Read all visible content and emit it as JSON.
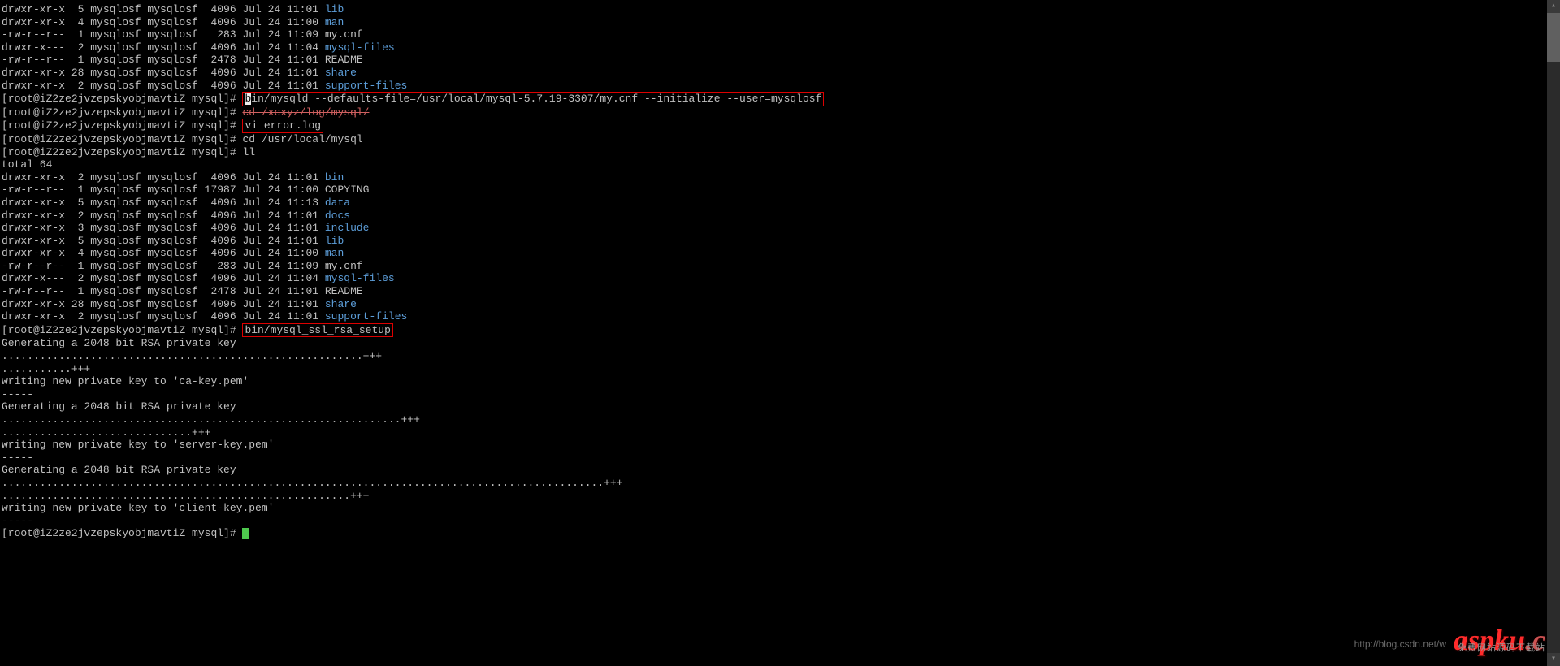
{
  "colors": {
    "dir": "#5c9dd8",
    "text": "#c0c0c0",
    "bg": "#000000",
    "box": "#d00000",
    "cursor": "#4ec94e"
  },
  "prompt": "[root@iZ2ze2jvzepskyobjmavtiZ mysql]# ",
  "listing1": [
    {
      "perm": "drwxr-xr-x",
      "n": "5",
      "u": "mysqlosf",
      "g": "mysqlosf",
      "size": "4096",
      "date": "Jul 24 11:01",
      "name": "lib",
      "dir": true
    },
    {
      "perm": "drwxr-xr-x",
      "n": "4",
      "u": "mysqlosf",
      "g": "mysqlosf",
      "size": "4096",
      "date": "Jul 24 11:00",
      "name": "man",
      "dir": true
    },
    {
      "perm": "-rw-r--r--",
      "n": "1",
      "u": "mysqlosf",
      "g": "mysqlosf",
      "size": "283",
      "date": "Jul 24 11:09",
      "name": "my.cnf",
      "dir": false
    },
    {
      "perm": "drwxr-x---",
      "n": "2",
      "u": "mysqlosf",
      "g": "mysqlosf",
      "size": "4096",
      "date": "Jul 24 11:04",
      "name": "mysql-files",
      "dir": true
    },
    {
      "perm": "-rw-r--r--",
      "n": "1",
      "u": "mysqlosf",
      "g": "mysqlosf",
      "size": "2478",
      "date": "Jul 24 11:01",
      "name": "README",
      "dir": false
    },
    {
      "perm": "drwxr-xr-x",
      "n": "28",
      "u": "mysqlosf",
      "g": "mysqlosf",
      "size": "4096",
      "date": "Jul 24 11:01",
      "name": "share",
      "dir": true
    },
    {
      "perm": "drwxr-xr-x",
      "n": "2",
      "u": "mysqlosf",
      "g": "mysqlosf",
      "size": "4096",
      "date": "Jul 24 11:01",
      "name": "support-files",
      "dir": true
    }
  ],
  "cmd1_firstchar": "b",
  "cmd1_rest": "in/mysqld --defaults-file=/usr/local/mysql-5.7.19-3307/my.cnf --initialize --user=mysqlosf",
  "cmd2": "cd /xcxyz/log/mysql/",
  "cmd3": "vi error.log",
  "cmd4": "cd /usr/local/mysql",
  "cmd5": "ll",
  "total": "total 64",
  "listing2": [
    {
      "perm": "drwxr-xr-x",
      "n": "2",
      "u": "mysqlosf",
      "g": "mysqlosf",
      "size": "4096",
      "date": "Jul 24 11:01",
      "name": "bin",
      "dir": true
    },
    {
      "perm": "-rw-r--r--",
      "n": "1",
      "u": "mysqlosf",
      "g": "mysqlosf",
      "size": "17987",
      "date": "Jul 24 11:00",
      "name": "COPYING",
      "dir": false
    },
    {
      "perm": "drwxr-xr-x",
      "n": "5",
      "u": "mysqlosf",
      "g": "mysqlosf",
      "size": "4096",
      "date": "Jul 24 11:13",
      "name": "data",
      "dir": true
    },
    {
      "perm": "drwxr-xr-x",
      "n": "2",
      "u": "mysqlosf",
      "g": "mysqlosf",
      "size": "4096",
      "date": "Jul 24 11:01",
      "name": "docs",
      "dir": true
    },
    {
      "perm": "drwxr-xr-x",
      "n": "3",
      "u": "mysqlosf",
      "g": "mysqlosf",
      "size": "4096",
      "date": "Jul 24 11:01",
      "name": "include",
      "dir": true
    },
    {
      "perm": "drwxr-xr-x",
      "n": "5",
      "u": "mysqlosf",
      "g": "mysqlosf",
      "size": "4096",
      "date": "Jul 24 11:01",
      "name": "lib",
      "dir": true
    },
    {
      "perm": "drwxr-xr-x",
      "n": "4",
      "u": "mysqlosf",
      "g": "mysqlosf",
      "size": "4096",
      "date": "Jul 24 11:00",
      "name": "man",
      "dir": true
    },
    {
      "perm": "-rw-r--r--",
      "n": "1",
      "u": "mysqlosf",
      "g": "mysqlosf",
      "size": "283",
      "date": "Jul 24 11:09",
      "name": "my.cnf",
      "dir": false
    },
    {
      "perm": "drwxr-x---",
      "n": "2",
      "u": "mysqlosf",
      "g": "mysqlosf",
      "size": "4096",
      "date": "Jul 24 11:04",
      "name": "mysql-files",
      "dir": true
    },
    {
      "perm": "-rw-r--r--",
      "n": "1",
      "u": "mysqlosf",
      "g": "mysqlosf",
      "size": "2478",
      "date": "Jul 24 11:01",
      "name": "README",
      "dir": false
    },
    {
      "perm": "drwxr-xr-x",
      "n": "28",
      "u": "mysqlosf",
      "g": "mysqlosf",
      "size": "4096",
      "date": "Jul 24 11:01",
      "name": "share",
      "dir": true
    },
    {
      "perm": "drwxr-xr-x",
      "n": "2",
      "u": "mysqlosf",
      "g": "mysqlosf",
      "size": "4096",
      "date": "Jul 24 11:01",
      "name": "support-files",
      "dir": true
    }
  ],
  "cmd6": "bin/mysql_ssl_rsa_setup",
  "rsa": {
    "gen": "Generating a 2048 bit RSA private key",
    "dots1": ".........................................................+++",
    "dots2": "...........+++",
    "w1": "writing new private key to 'ca-key.pem'",
    "sep": "-----",
    "dots3": "...............................................................+++",
    "dots4": "..............................+++",
    "w2": "writing new private key to 'server-key.pem'",
    "dots5": "...............................................................................................+++",
    "dots6": ".......................................................+++",
    "w3": "writing new private key to 'client-key.pem'"
  },
  "watermark": {
    "logo_a": "aspku",
    "logo_b": ".c",
    "sub": "免费网站源码下载站",
    "url": "http://blog.csdn.net/w"
  }
}
